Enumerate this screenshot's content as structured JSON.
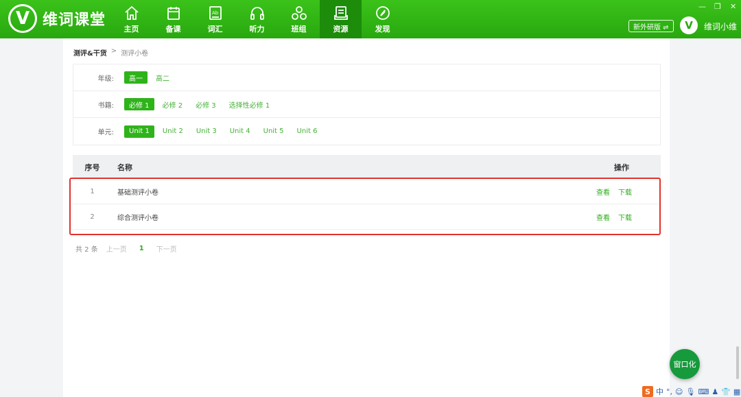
{
  "app": {
    "logo_letter": "V",
    "name": "维词课堂"
  },
  "nav": [
    {
      "label": "主页",
      "icon": "home-icon"
    },
    {
      "label": "备课",
      "icon": "calendar-icon"
    },
    {
      "label": "词汇",
      "icon": "book-ab-icon"
    },
    {
      "label": "听力",
      "icon": "headphones-icon"
    },
    {
      "label": "班组",
      "icon": "group-icon"
    },
    {
      "label": "资源",
      "icon": "resource-icon",
      "active": true
    },
    {
      "label": "发现",
      "icon": "compass-icon"
    }
  ],
  "header": {
    "edition": "新外研版 ⇌",
    "avatar_letter": "V",
    "user_name": "维词小维"
  },
  "breadcrumb": {
    "root": "测评&干货",
    "sep": ">",
    "current": "测评小卷"
  },
  "filters": {
    "grade": {
      "label": "年级:",
      "options": [
        "高一",
        "高二"
      ],
      "selected": 0
    },
    "book": {
      "label": "书籍:",
      "options": [
        "必修 1",
        "必修 2",
        "必修 3",
        "选择性必修 1"
      ],
      "selected": 0
    },
    "unit": {
      "label": "单元:",
      "options": [
        "Unit 1",
        "Unit 2",
        "Unit 3",
        "Unit 4",
        "Unit 5",
        "Unit 6"
      ],
      "selected": 0
    }
  },
  "table": {
    "headers": {
      "index": "序号",
      "name": "名称",
      "op": "操作"
    },
    "rows": [
      {
        "index": "1",
        "name": "基础测评小卷",
        "view": "查看",
        "download": "下载"
      },
      {
        "index": "2",
        "name": "综合测评小卷",
        "view": "查看",
        "download": "下载"
      }
    ]
  },
  "pager": {
    "total": "共 2 条",
    "prev": "上一页",
    "page": "1",
    "next": "下一页"
  },
  "float_button": "窗口化",
  "ime": {
    "logo": "S",
    "lang": "中"
  },
  "colors": {
    "brand": "#2aa811",
    "accent": "#2fb31a",
    "highlight": "#e2312b"
  }
}
